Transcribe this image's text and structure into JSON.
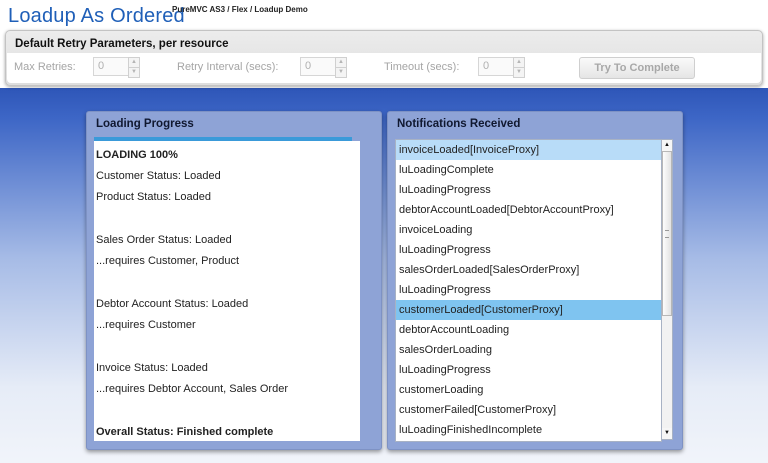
{
  "app": {
    "title": "Loadup As Ordered",
    "subtitle": "PureMVC AS3 / Flex / Loadup Demo"
  },
  "retry": {
    "title": "Default Retry Parameters, per resource",
    "max_retries_label": "Max Retries:",
    "max_retries_value": "0",
    "interval_label": "Retry Interval (secs):",
    "interval_value": "0",
    "timeout_label": "Timeout (secs):",
    "timeout_value": "0",
    "try_button": "Try To Complete"
  },
  "loading": {
    "title": "Loading Progress",
    "progress_percent": 100,
    "lines": [
      "LOADING 100%",
      "Customer Status: Loaded",
      "Product Status: Loaded",
      "Sales Order Status: Loaded",
      "...requires Customer, Product",
      "Debtor Account Status: Loaded",
      "...requires Customer",
      "Invoice Status: Loaded",
      "...requires Debtor Account, Sales Order",
      "Overall Status: Finished complete"
    ]
  },
  "notifications": {
    "title": "Notifications Received",
    "items": [
      "invoiceLoaded[InvoiceProxy]",
      "luLoadingComplete",
      "luLoadingProgress",
      "debtorAccountLoaded[DebtorAccountProxy]",
      "invoiceLoading",
      "luLoadingProgress",
      "salesOrderLoaded[SalesOrderProxy]",
      "luLoadingProgress",
      "customerLoaded[CustomerProxy]",
      "debtorAccountLoading",
      "salesOrderLoading",
      "luLoadingProgress",
      "customerLoading",
      "customerFailed[CustomerProxy]",
      "luLoadingFinishedIncomplete"
    ],
    "selected_index": 0,
    "hover_index": 8
  },
  "icons": {
    "stepper_up": "chevron-up-icon",
    "stepper_down": "chevron-down-icon",
    "scroll_up": "scroll-up-arrow-icon",
    "scroll_down": "scroll-down-arrow-icon"
  },
  "colors": {
    "title_blue": "#1f5fb8",
    "background_blue": "#2e56b8",
    "panel_header": "#8ea3d6",
    "selected_row": "#b8dcf8",
    "hover_row": "#7fc4f0",
    "progress_fill": "#3a9ad9"
  }
}
